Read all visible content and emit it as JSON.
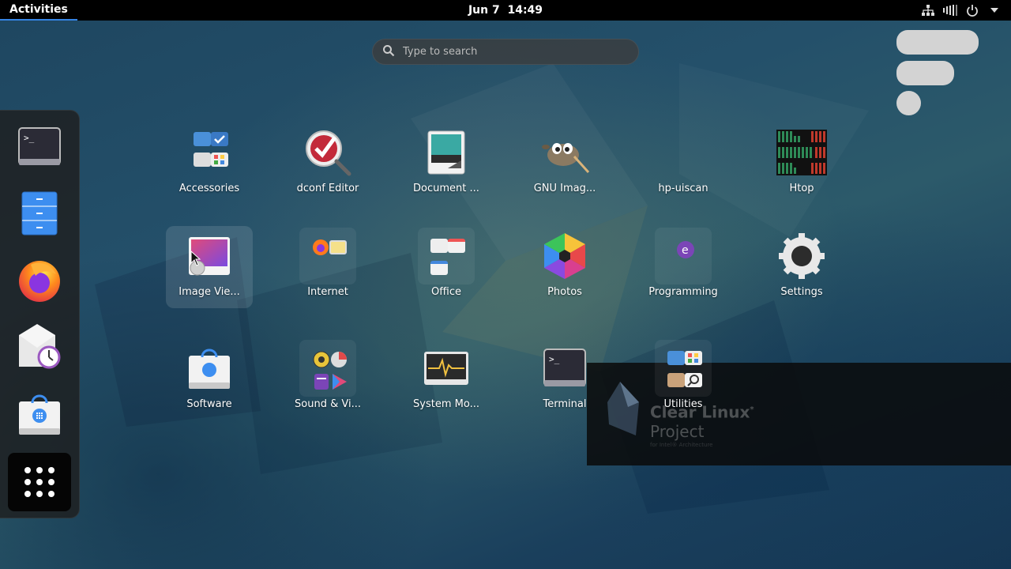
{
  "topbar": {
    "activities": "Activities",
    "clock": "Jun 7  14:49",
    "icons": [
      "network-icon",
      "volume-icon",
      "power-icon",
      "chevron-down-icon"
    ]
  },
  "search": {
    "placeholder": "Type to search"
  },
  "dash": {
    "items": [
      "terminal",
      "files",
      "firefox",
      "evolution",
      "software"
    ],
    "show_apps": "show-applications"
  },
  "apps": [
    {
      "label": "Accessories",
      "icon": "accessories-folder"
    },
    {
      "label": "dconf Editor",
      "icon": "dconf-editor"
    },
    {
      "label": "Document ...",
      "icon": "document-scanner"
    },
    {
      "label": "GNU Imag...",
      "icon": "gimp"
    },
    {
      "label": "hp-uiscan",
      "icon": "hp-uiscan"
    },
    {
      "label": "Htop",
      "icon": "htop"
    },
    {
      "label": "Image Vie...",
      "icon": "image-viewer"
    },
    {
      "label": "Internet",
      "icon": "internet-folder"
    },
    {
      "label": "Office",
      "icon": "office-folder"
    },
    {
      "label": "Photos",
      "icon": "photos"
    },
    {
      "label": "Programming",
      "icon": "programming-folder"
    },
    {
      "label": "Settings",
      "icon": "settings"
    },
    {
      "label": "Software",
      "icon": "software"
    },
    {
      "label": "Sound & Vi...",
      "icon": "sound-video-folder"
    },
    {
      "label": "System Mo...",
      "icon": "system-monitor"
    },
    {
      "label": "Terminal",
      "icon": "terminal"
    },
    {
      "label": "Utilities",
      "icon": "utilities-folder"
    }
  ],
  "notification": {
    "logo_line1": "Clear Linux",
    "logo_mark": "*",
    "logo_line2": "Project",
    "logo_sub": "for Intel® Architecture"
  },
  "colors": {
    "accent": "#3584e4",
    "topbar": "#000000",
    "dash_bg": "#1e1e1e"
  }
}
